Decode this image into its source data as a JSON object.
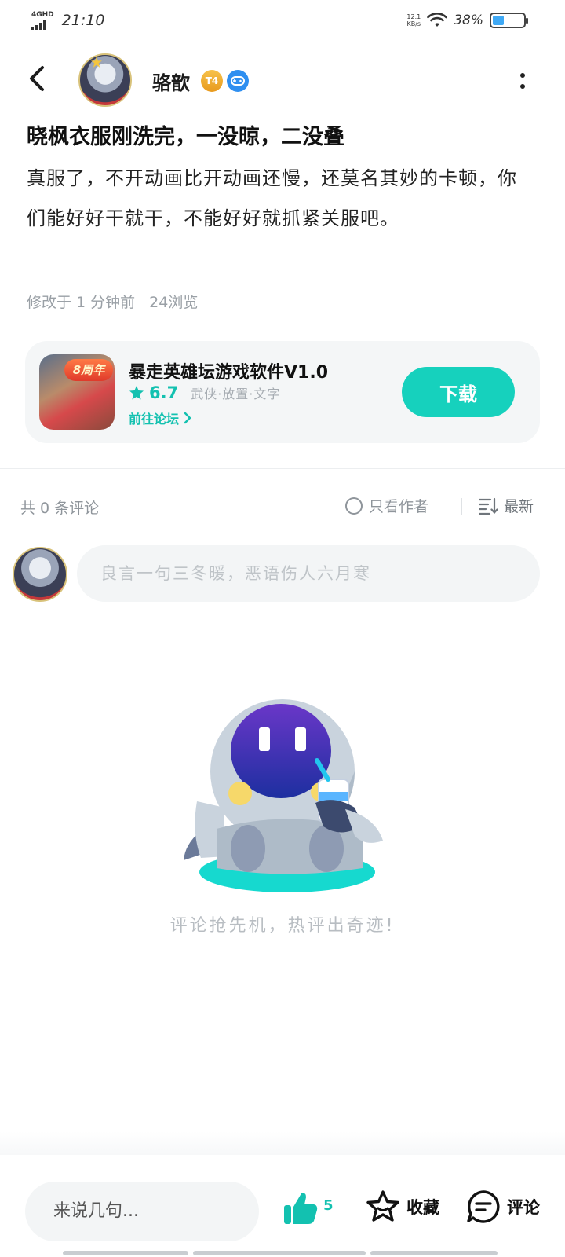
{
  "status_bar": {
    "network": "4GHD",
    "time": "21:10",
    "speed_value": "12.1",
    "speed_unit": "KB/s",
    "battery": "38%",
    "battery_level": 0.38
  },
  "header": {
    "username": "骆歆",
    "level_badge": "T4",
    "icons": [
      "back-icon",
      "avatar",
      "level-badge-icon",
      "gamepad-icon",
      "more-icon"
    ]
  },
  "post": {
    "title": "晓枫衣服刚洗完，一没晾，二没叠",
    "body": "真服了，不开动画比开动画还慢，还莫名其妙的卡顿，你们能好好干就干，不能好好就抓紧关服吧。",
    "edited": "修改于 1 分钟前",
    "views": "24浏览"
  },
  "app_card": {
    "icon_badge": "8周年",
    "name": "暴走英雄坛游戏软件V1.0",
    "rating": "6.7",
    "tags": "武侠·放置·文字",
    "forum_link": "前往论坛",
    "download_label": "下载",
    "accent_color": "#16d1bd"
  },
  "comments": {
    "count_label": "共 0 条评论",
    "author_only_label": "只看作者",
    "sort_label": "最新",
    "input_placeholder": "良言一句三冬暖，恶语伤人六月寒",
    "empty_text": "评论抢先机，热评出奇迹!"
  },
  "bottom_bar": {
    "say_placeholder": "来说几句...",
    "like_count": "5",
    "favorite_label": "收藏",
    "comment_label": "评论"
  }
}
